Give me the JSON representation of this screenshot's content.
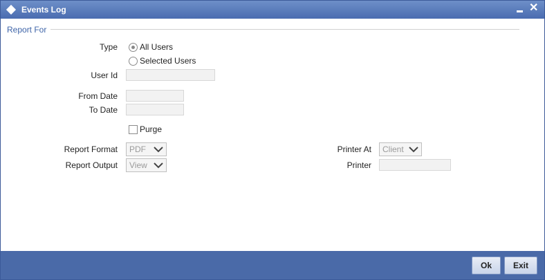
{
  "window": {
    "title": "Events Log",
    "minimize_icon": "minimize-icon",
    "close_icon": "close-icon"
  },
  "section": {
    "title": "Report For"
  },
  "type": {
    "label": "Type",
    "options": [
      {
        "label": "All Users",
        "checked": true
      },
      {
        "label": "Selected Users",
        "checked": false
      }
    ]
  },
  "user_id": {
    "label": "User Id",
    "value": ""
  },
  "from_date": {
    "label": "From Date",
    "value": ""
  },
  "to_date": {
    "label": "To Date",
    "value": ""
  },
  "purge": {
    "label": "Purge",
    "checked": false
  },
  "report_format": {
    "label": "Report Format",
    "value": "PDF"
  },
  "report_output": {
    "label": "Report Output",
    "value": "View"
  },
  "printer_at": {
    "label": "Printer At",
    "value": "Client"
  },
  "printer": {
    "label": "Printer",
    "value": ""
  },
  "buttons": {
    "ok": "Ok",
    "exit": "Exit"
  },
  "colors": {
    "titlebar": "#4a6cb0",
    "section_title": "#3e64a8",
    "footer": "#4a6aa8"
  }
}
